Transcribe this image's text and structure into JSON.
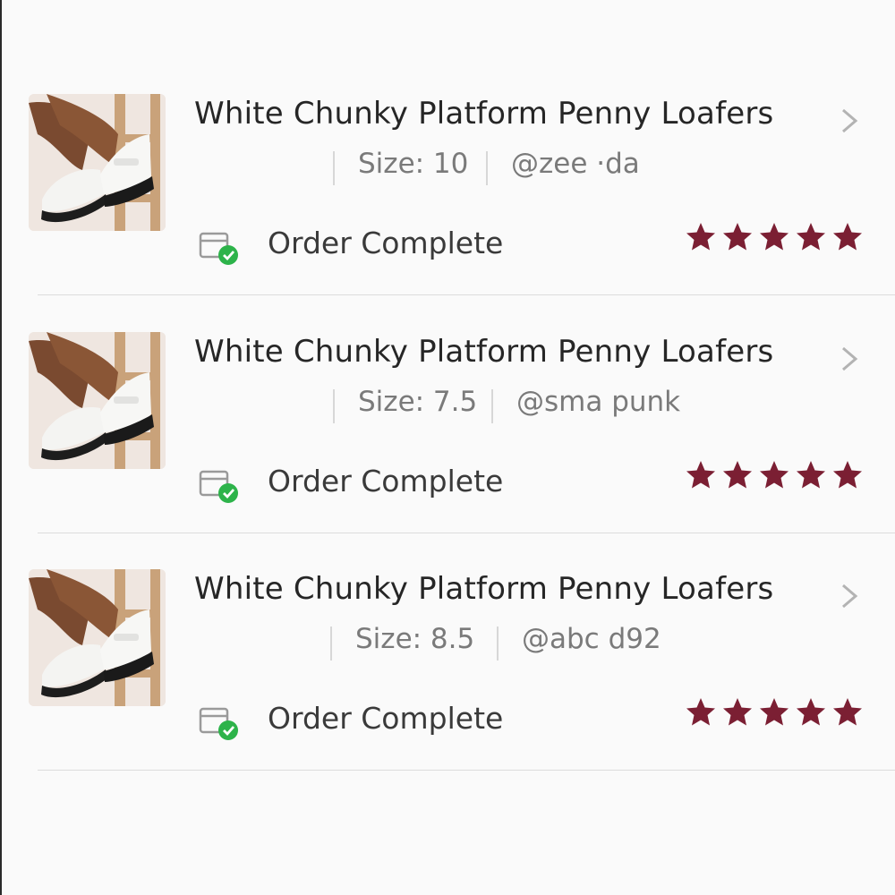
{
  "colors": {
    "star": "#7b1f33",
    "check": "#2db34a",
    "divider": "#dcdcdc"
  },
  "orders": [
    {
      "title": "White Chunky Platform Penny Loafers",
      "size": "Size: 10",
      "user": "@zee  ·da",
      "status": "Order Complete",
      "rating": 5,
      "rating_max": 5
    },
    {
      "title": "White Chunky Platform Penny Loafers",
      "size": "Size: 7.5",
      "user": "@sma    punk",
      "status": "Order Complete",
      "rating": 5,
      "rating_max": 5
    },
    {
      "title": "White Chunky Platform Penny Loafers",
      "size": "Size: 8.5",
      "user": "@abc   d92",
      "status": "Order Complete",
      "rating": 5,
      "rating_max": 5
    }
  ],
  "icons": {
    "chevron": "chevron-right-icon",
    "status": "package-check-icon",
    "star": "star-icon"
  }
}
